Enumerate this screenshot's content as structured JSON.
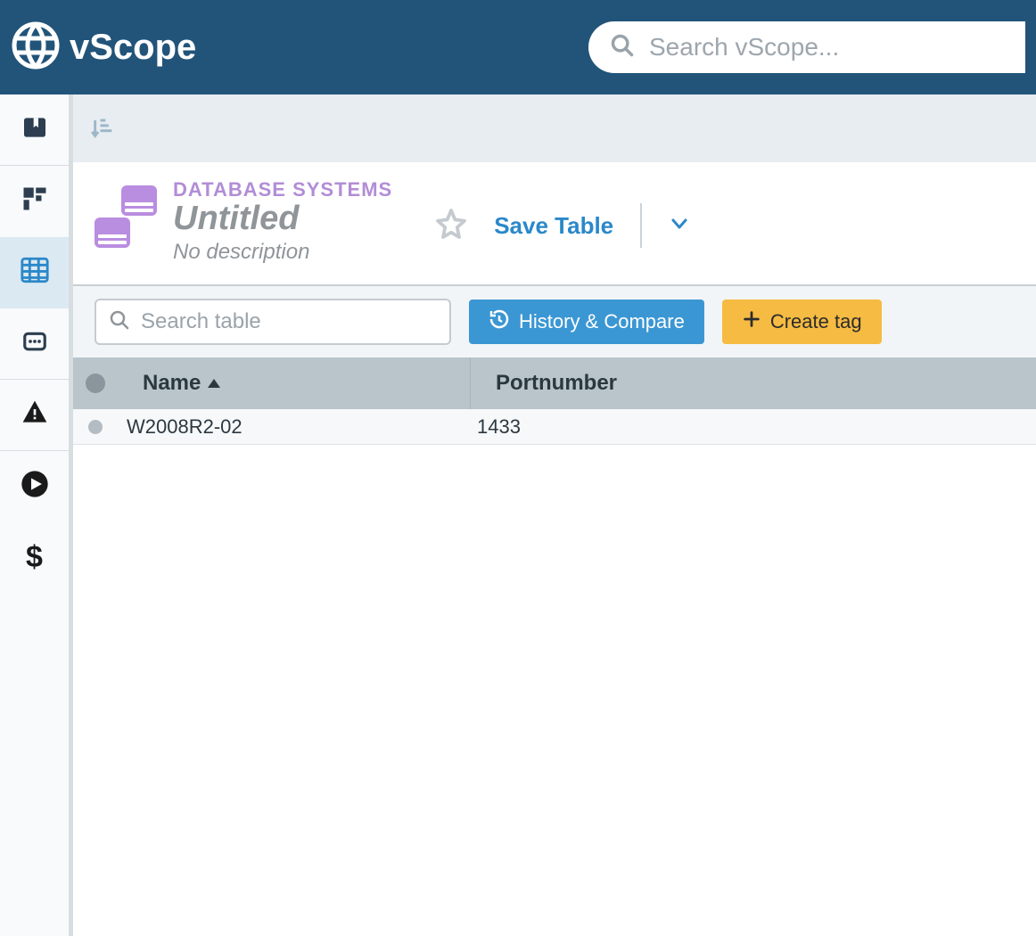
{
  "header": {
    "brand": "vScope",
    "search_placeholder": "Search vScope..."
  },
  "sidebar": {
    "items": [
      {
        "icon": "bookmark-book-icon"
      },
      {
        "icon": "dashboard-icon"
      },
      {
        "icon": "table-icon",
        "active": true
      },
      {
        "icon": "message-icon"
      },
      {
        "icon": "alert-icon"
      },
      {
        "icon": "play-icon"
      },
      {
        "icon": "dollar-icon"
      }
    ]
  },
  "page": {
    "category": "DATABASE SYSTEMS",
    "title": "Untitled",
    "description": "No description",
    "save_label": "Save Table"
  },
  "toolbar": {
    "search_placeholder": "Search table",
    "history_label": "History & Compare",
    "create_tag_label": "Create tag"
  },
  "table": {
    "columns": [
      {
        "key": "name",
        "label": "Name",
        "sorted": "asc"
      },
      {
        "key": "portnumber",
        "label": "Portnumber"
      }
    ],
    "rows": [
      {
        "name": "W2008R2-02",
        "portnumber": "1433"
      }
    ]
  }
}
